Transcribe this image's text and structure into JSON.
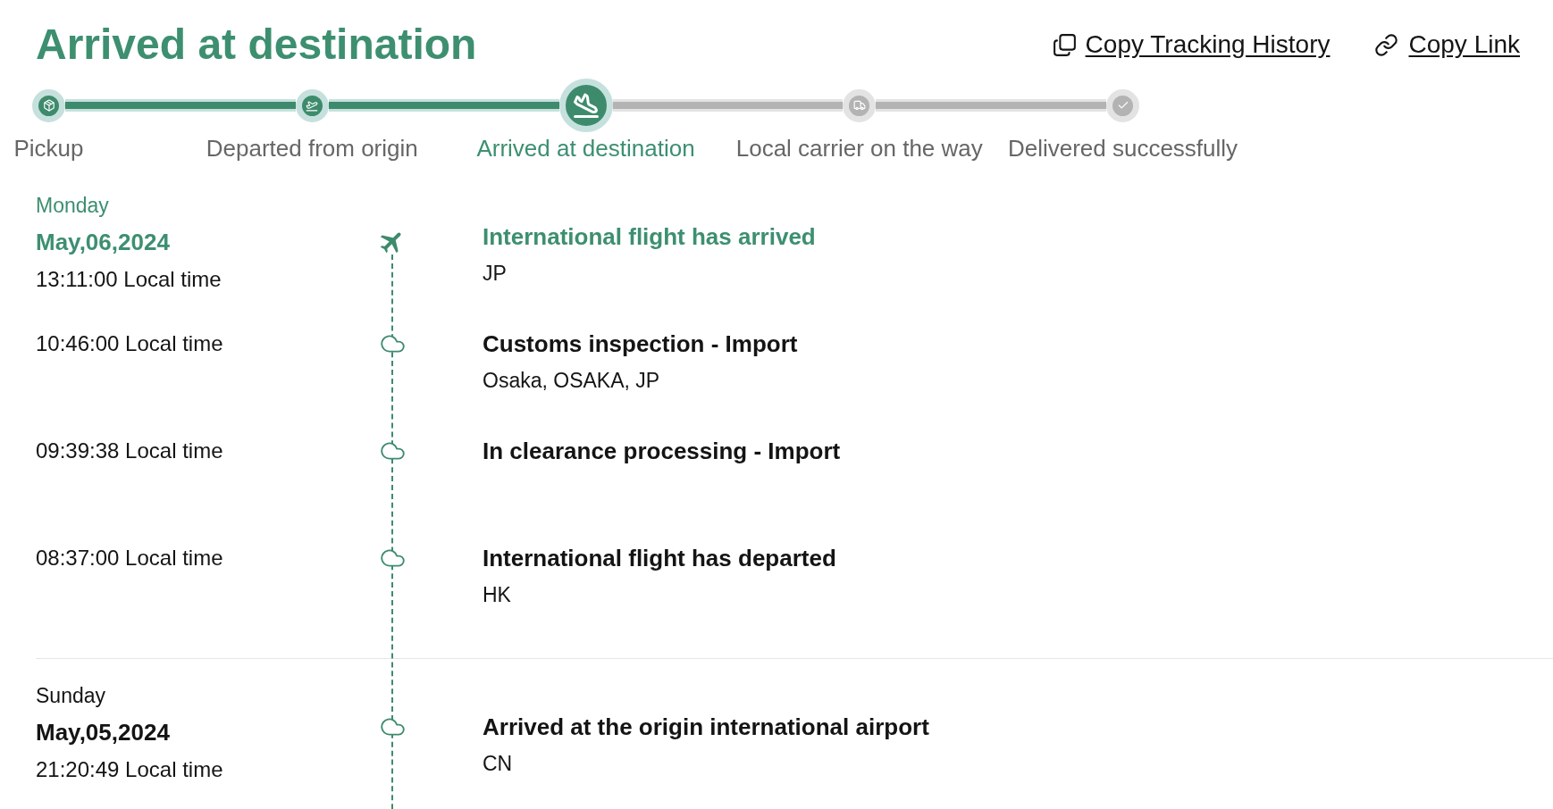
{
  "title": "Arrived at destination",
  "actions": [
    {
      "label": "Copy Tracking History"
    },
    {
      "label": "Copy Link"
    }
  ],
  "steps": [
    {
      "label": "Pickup",
      "reached": true,
      "current": false
    },
    {
      "label": "Departed from origin",
      "reached": true,
      "current": false
    },
    {
      "label": "Arrived at destination",
      "reached": true,
      "current": true
    },
    {
      "label": "Local carrier on the way",
      "reached": false,
      "current": false
    },
    {
      "label": "Delivered successfully",
      "reached": false,
      "current": false
    }
  ],
  "days": [
    {
      "weekday": "Monday",
      "date": "May,06,2024",
      "current": true,
      "events": [
        {
          "time": "13:11:00 Local time",
          "title": "International flight has arrived",
          "detail": "JP",
          "current": true
        },
        {
          "time": "10:46:00 Local time",
          "title": "Customs inspection - Import",
          "detail": "Osaka, OSAKA, JP",
          "current": false
        },
        {
          "time": "09:39:38 Local time",
          "title": "In clearance processing - Import",
          "current": false
        },
        {
          "time": "08:37:00 Local time",
          "title": "International flight has departed",
          "detail": "HK",
          "current": false
        }
      ]
    },
    {
      "weekday": "Sunday",
      "date": "May,05,2024",
      "current": false,
      "events": [
        {
          "time": "21:20:49 Local time",
          "title": "Arrived at the origin international airport",
          "detail": "CN",
          "current": false
        }
      ]
    }
  ]
}
